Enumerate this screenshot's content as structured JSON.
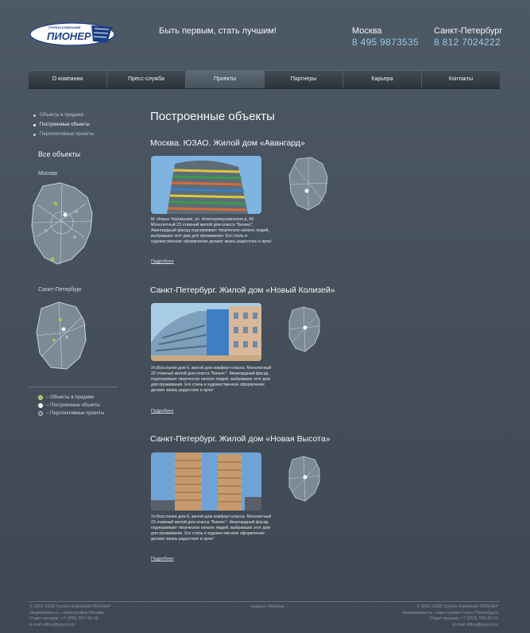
{
  "header": {
    "logo_small": "ГРУППА КОМПАНИЙ",
    "logo_text": "ПИОНЕР",
    "slogan": "Быть первым, стать лучшим!",
    "contacts": [
      {
        "city": "Москва",
        "phone": "8 495 9873535"
      },
      {
        "city": "Санкт-Петербург",
        "phone": "8 812 7024222"
      }
    ]
  },
  "nav": {
    "items": [
      "О компании",
      "Пресс-служба",
      "Проекты",
      "Партнеры",
      "Карьера",
      "Контакты"
    ],
    "active": "Проекты"
  },
  "sidebar": {
    "links": [
      "Объекты в продаже",
      "Построенные объекты",
      "Перспективные проекты"
    ],
    "current": "Построенные объекты",
    "all_objects": "Все объекты",
    "moscow": "Москва",
    "spb": "Санкт-Петербург",
    "legend": [
      "– Объекты в продаже",
      "– Построенные объекты",
      "– Перспективные проекты"
    ],
    "colors": {
      "sale": "#a8bd52",
      "built": "#ffffff",
      "future": "#a9b0b6"
    }
  },
  "main": {
    "title": "Построенные объекты",
    "objects": [
      {
        "title": "Москва. ЮЗАО. Жилой дом «Авангард»",
        "desc": "М. Новые Черемушки, ул. Новочеремушкинская д. 60 Монолитный 22-этажный жилой дом класса \"Бизнес\". Авангардный фасад подчеркивает творческое начало людей, выбравших этот дом для проживания. Его стиль и художественное оформление делают жизнь радостнее и ярче!",
        "more": "Подробнее"
      },
      {
        "title": "Санкт-Петербург. Жилой дом «Новый Колизей»",
        "desc": "Ул.Восстания дом 6, жилой дом комфорт-класса. Монолитный 22-этажный жилой дом класса \"Бизнес\". Авангардный фасад подчеркивает творческое начало людей, выбравших этот дом для проживания. Его стиль и художественное оформление делают жизнь радостнее и ярче!",
        "more": "Подробнее"
      },
      {
        "title": "Санкт-Петербург. Жилой дом «Новая Высота»",
        "desc": "Ул.Восстания дом 6, жилой дом комфорт-класса. Монолитный 22-этажный жилой дом класса \"Бизнес\". Авангардный фасад подчеркивает творческое начало людей, выбравших этот дом для проживания. Его стиль и художественное оформление делают жизнь радостнее и ярче!",
        "more": "Подробнее"
      }
    ]
  },
  "footer": {
    "left": [
      "© 2001-2008 Группа Компаний ПИОНЕР",
      "Недвижимость, новостройки Москвы",
      "Отдел продаж: +7 (495) 987-35-35",
      "E-mail office@pionor.ru"
    ],
    "center": "создано Webway",
    "right": [
      "© 2001-2008 Группа Компаний ПИОНЕР",
      "Недвижимость, новостройки Санкт-Петербурга",
      "Отдел продаж: +7 (812) 702-42-22",
      "E-mail office@pionor.ru"
    ]
  }
}
